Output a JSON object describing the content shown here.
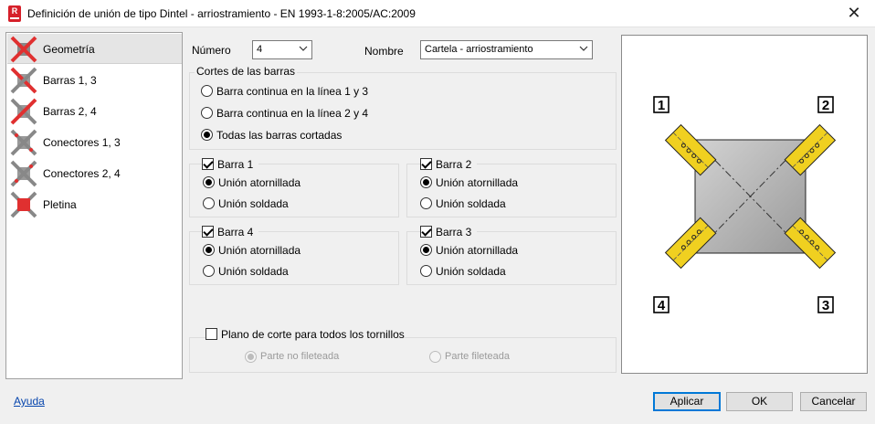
{
  "window": {
    "title": "Definición de unión de tipo Dintel - arriostramiento  - EN 1993-1-8:2005/AC:2009",
    "app_icon_letter": "R",
    "close_glyph": "✕"
  },
  "sidebar": {
    "items": [
      {
        "label": "Geometría",
        "icon": "geometry-joint-icon",
        "selected": true
      },
      {
        "label": "Barras 1, 3",
        "icon": "bars-joint-icon"
      },
      {
        "label": "Barras 2, 4",
        "icon": "bars-joint-icon"
      },
      {
        "label": "Conectores 1, 3",
        "icon": "connectors-joint-icon"
      },
      {
        "label": "Conectores 2, 4",
        "icon": "connectors-joint-icon"
      },
      {
        "label": "Pletina",
        "icon": "plate-joint-icon"
      }
    ]
  },
  "form": {
    "numero_label": "Número",
    "numero_value": "4",
    "nombre_label": "Nombre",
    "nombre_value": "Cartela - arriostramiento",
    "cortes": {
      "title": "Cortes de las barras",
      "options": [
        {
          "label": "Barra continua en la línea 1 y 3",
          "checked": false
        },
        {
          "label": "Barra continua en la línea 2 y 4",
          "checked": false
        },
        {
          "label": "Todas las barras cortadas",
          "checked": true
        }
      ]
    },
    "barra1": {
      "label": "Barra 1",
      "checked": true,
      "bolted": "Unión atornillada",
      "welded": "Unión soldada",
      "selected": "bolted"
    },
    "barra2": {
      "label": "Barra 2",
      "checked": true,
      "bolted": "Unión atornillada",
      "welded": "Unión soldada",
      "selected": "bolted"
    },
    "barra4": {
      "label": "Barra 4",
      "checked": true,
      "bolted": "Unión atornillada",
      "welded": "Unión soldada",
      "selected": "bolted"
    },
    "barra3": {
      "label": "Barra 3",
      "checked": true,
      "bolted": "Unión atornillada",
      "welded": "Unión soldada",
      "selected": "bolted"
    },
    "plano": {
      "label": "Plano de corte para todos los tornillos",
      "checked": false,
      "option_a": "Parte no fileteada",
      "option_b": "Parte fileteada"
    }
  },
  "preview": {
    "corner_labels": [
      "1",
      "2",
      "3",
      "4"
    ],
    "colors": {
      "bar": "#f0d020",
      "plate": "#b8b8b8",
      "stroke": "#222222"
    }
  },
  "footer": {
    "help_link": "Ayuda",
    "apply": "Aplicar",
    "ok": "OK",
    "cancel": "Cancelar"
  }
}
